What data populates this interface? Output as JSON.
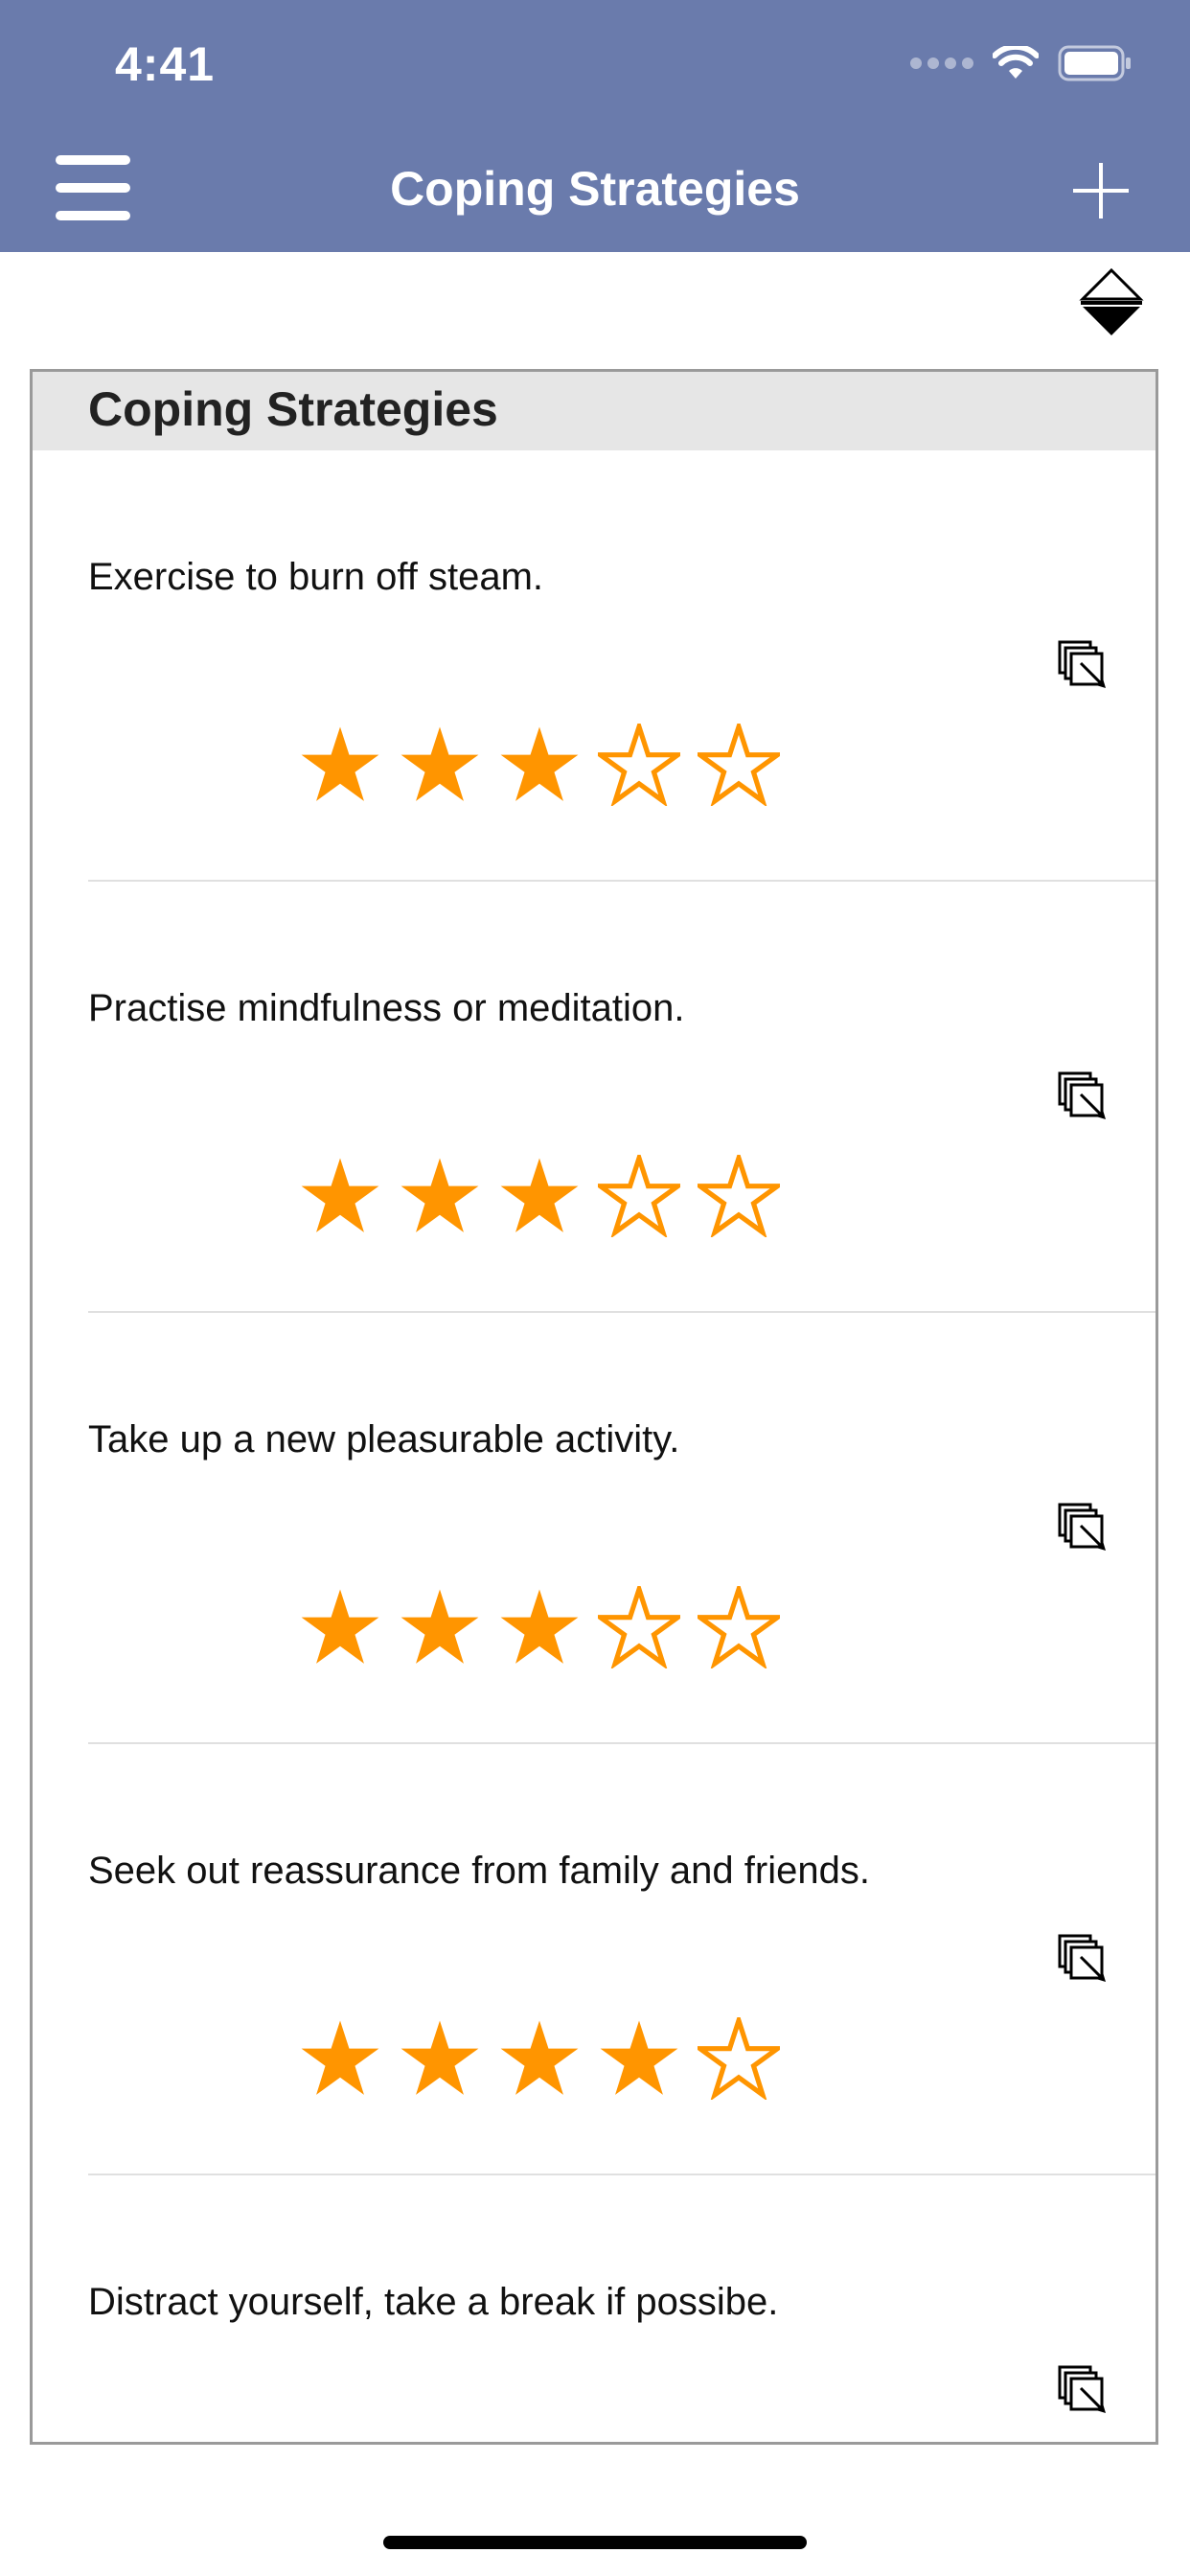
{
  "status_bar": {
    "time": "4:41"
  },
  "nav": {
    "title": "Coping Strategies",
    "menu_icon": "hamburger-menu-icon",
    "add_icon": "plus-icon"
  },
  "sort_icon": "sort-toggle-icon",
  "panel": {
    "header": "Coping Strategies",
    "items": [
      {
        "text": "Exercise to burn off steam.",
        "rating": 3,
        "max_rating": 5
      },
      {
        "text": "Practise mindfulness or meditation.",
        "rating": 3,
        "max_rating": 5
      },
      {
        "text": "Take up a new pleasurable activity.",
        "rating": 3,
        "max_rating": 5
      },
      {
        "text": "Seek out reassurance from family and friends.",
        "rating": 4,
        "max_rating": 5
      },
      {
        "text": "Distract yourself, take a break if possibe.",
        "rating": null,
        "max_rating": 5
      }
    ]
  },
  "colors": {
    "nav_bar": "#6a7bac",
    "star": "#ff9500",
    "header_bg": "#e6e6e6"
  }
}
